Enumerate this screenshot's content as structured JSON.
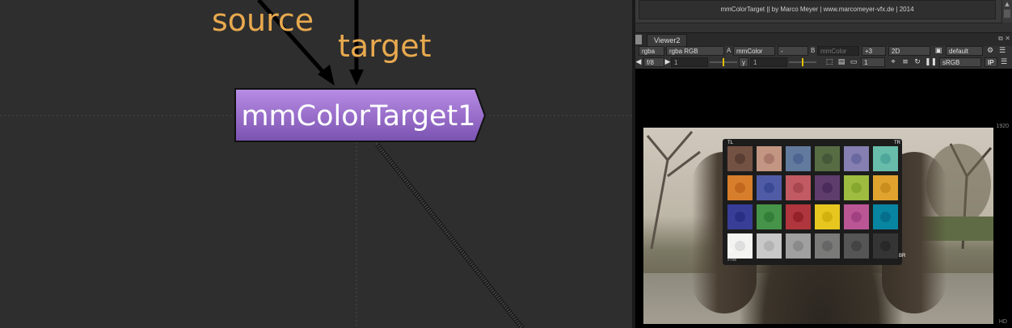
{
  "nodegraph": {
    "input_labels": [
      "source",
      "target"
    ],
    "node_name": "mmColorTarget1",
    "colors": {
      "label": "#e8a94e",
      "node_top": "#b98de6",
      "node_bottom": "#7a52b0"
    }
  },
  "credits_text": "mmColorTarget  ||  by Marco Meyer  |   www.marcomeyer-vfx.de  |   2014",
  "viewer": {
    "tab_label": "Viewer2",
    "toolbar1": {
      "channels": "rgba",
      "layer": "rgba RGB",
      "a_label": "A",
      "a_input": "mmColor",
      "operation": "-",
      "b_label": "B",
      "b_input": "mmColor",
      "frame_offset": "+3",
      "view_mode": "2D",
      "lut": "default"
    },
    "toolbar2": {
      "fstop": "f/8",
      "gain_value": "1",
      "gamma_label": "y",
      "gamma_value": "1",
      "proxy": "1",
      "colorspace": "sRGB",
      "ip_label": "IP"
    },
    "resolution_label": "1920",
    "format_label": "HD",
    "corner_labels": {
      "tl": "TL",
      "tr": "TR",
      "bl": "BL",
      "br": "BR"
    },
    "chart_brand": "x-rite",
    "patch_colors": [
      [
        "#735244",
        "#c29682",
        "#627a9d",
        "#576c43",
        "#8580b1",
        "#67bdaa"
      ],
      [
        "#d67e2c",
        "#505ba6",
        "#c15a63",
        "#5e3c6c",
        "#9dbc40",
        "#e0a32e"
      ],
      [
        "#383d96",
        "#469449",
        "#af363c",
        "#e7c71f",
        "#bb5695",
        "#0885a1"
      ],
      [
        "#f3f3f2",
        "#c8c8c8",
        "#a0a0a0",
        "#7a7a79",
        "#555555",
        "#343434"
      ]
    ],
    "dot_colors": [
      [
        "#5a3d33",
        "#a9786b",
        "#4d6590",
        "#44593a",
        "#6a68a0",
        "#4fa79b"
      ],
      [
        "#c1671e",
        "#3b4995",
        "#a8474f",
        "#4a2b5b",
        "#86a82e",
        "#c98e1e"
      ],
      [
        "#2a2f86",
        "#337e38",
        "#952229",
        "#d2b10e",
        "#a24181",
        "#066f8b"
      ],
      [
        "#dedede",
        "#b3b3b3",
        "#8a8a8a",
        "#666666",
        "#444444",
        "#282828"
      ]
    ]
  }
}
